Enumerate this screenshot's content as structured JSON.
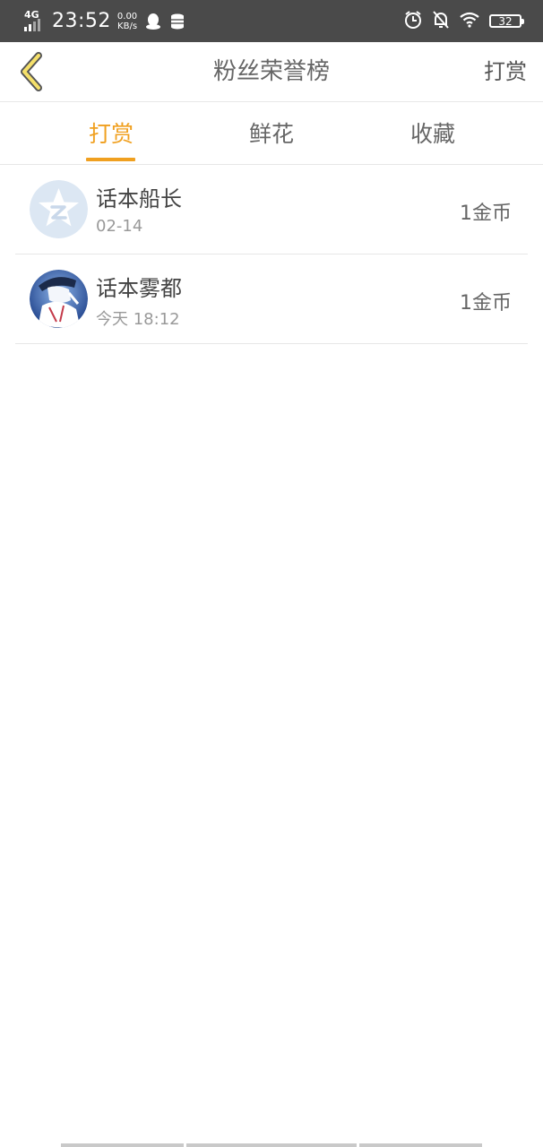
{
  "status_bar": {
    "network": "4G",
    "time": "23:52",
    "speed_value": "0.00",
    "speed_unit": "KB/s",
    "battery": "32"
  },
  "header": {
    "title": "粉丝荣誉榜",
    "right_action": "打赏"
  },
  "tabs": [
    {
      "label": "打赏",
      "active": true
    },
    {
      "label": "鲜花",
      "active": false
    },
    {
      "label": "收藏",
      "active": false
    }
  ],
  "list": [
    {
      "name": "话本船长",
      "time": "02-14",
      "amount": "1金币",
      "avatar": "qzone-avatar"
    },
    {
      "name": "话本雾都",
      "time": "今天 18:12",
      "amount": "1金币",
      "avatar": "anime-avatar"
    }
  ],
  "colors": {
    "accent": "#f0a020",
    "status_bar": "#4a4a4a"
  }
}
